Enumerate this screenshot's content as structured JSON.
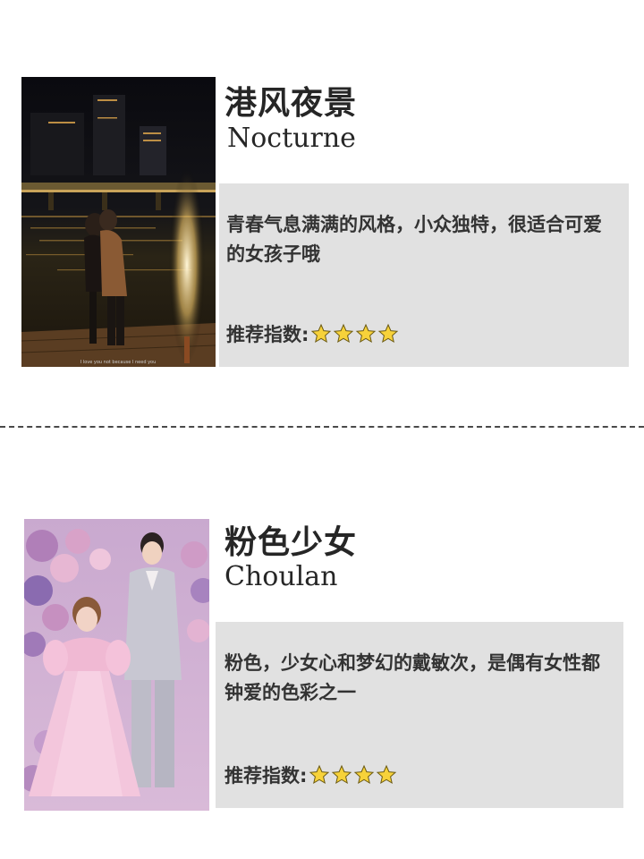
{
  "sections": [
    {
      "title_cn": "港风夜景",
      "title_en": "Nocturne",
      "description": "青春气息满满的风格，小众独特，很适合可爱的女孩子哦",
      "rating_label": "推荐指数:",
      "rating_stars": 4,
      "photo_caption": "I love you not because I need you",
      "photo": "night-riverside-couple-photo"
    },
    {
      "title_cn": "粉色少女",
      "title_en": "Choulan",
      "description": "粉色，少女心和梦幻的戴敏次，是偶有女性都钟爱的色彩之一",
      "rating_label": "推荐指数:",
      "rating_stars": 4,
      "photo": "pink-floral-couple-photo"
    }
  ],
  "colors": {
    "desc_box": "#e1e1e1",
    "star_fill": "#f7d23a",
    "star_stroke": "#6b5a12"
  }
}
